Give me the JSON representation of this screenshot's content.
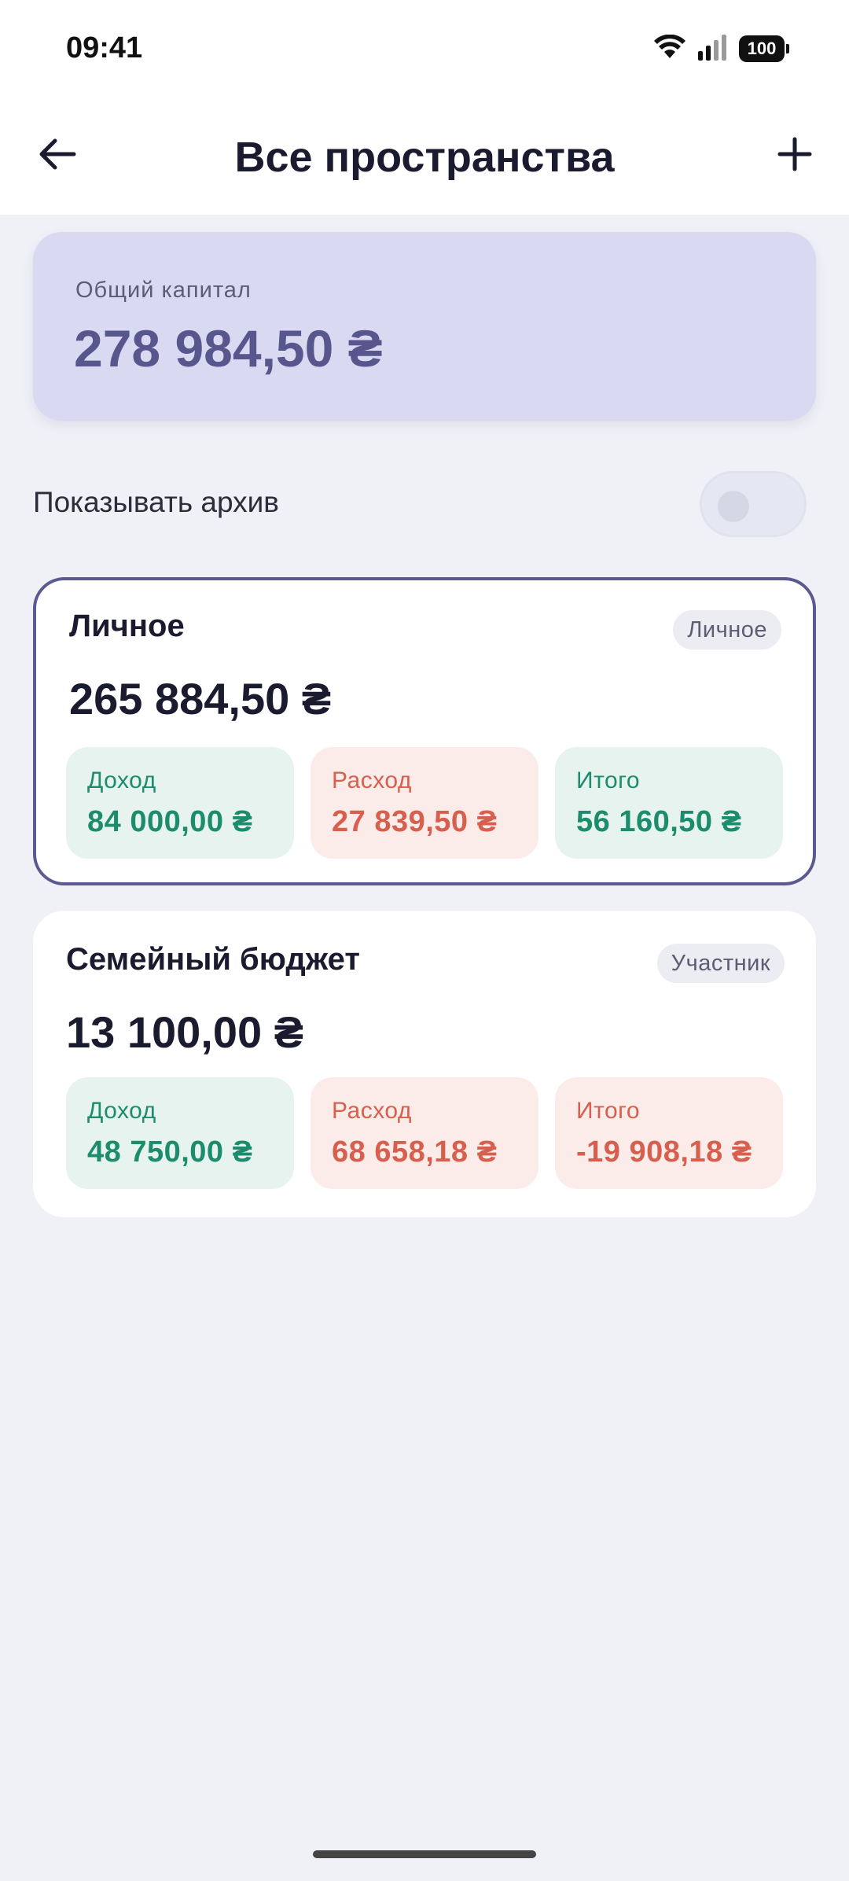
{
  "status_bar": {
    "time": "09:41",
    "battery": "100"
  },
  "app_bar": {
    "title": "Все пространства"
  },
  "capital": {
    "label": "Общий капитал",
    "value": "278 984,50 ₴"
  },
  "archive": {
    "label": "Показывать архив",
    "enabled": false
  },
  "spaces": [
    {
      "name": "Личное",
      "role": "Личное",
      "balance": "265 884,50 ₴",
      "selected": true,
      "income_label": "Доход",
      "income": "84 000,00 ₴",
      "expense_label": "Расход",
      "expense": "27 839,50 ₴",
      "total_label": "Итого",
      "total": "56 160,50 ₴",
      "total_positive": true
    },
    {
      "name": "Семейный бюджет",
      "role": "Участник",
      "balance": "13 100,00 ₴",
      "selected": false,
      "income_label": "Доход",
      "income": "48 750,00 ₴",
      "expense_label": "Расход",
      "expense": "68 658,18 ₴",
      "total_label": "Итого",
      "total": "-19 908,18 ₴",
      "total_positive": false
    }
  ],
  "colors": {
    "accent": "#5a5a90",
    "capital_bg": "#d9d9f2",
    "income": "#1d8c6c",
    "expense": "#d65f4e"
  }
}
